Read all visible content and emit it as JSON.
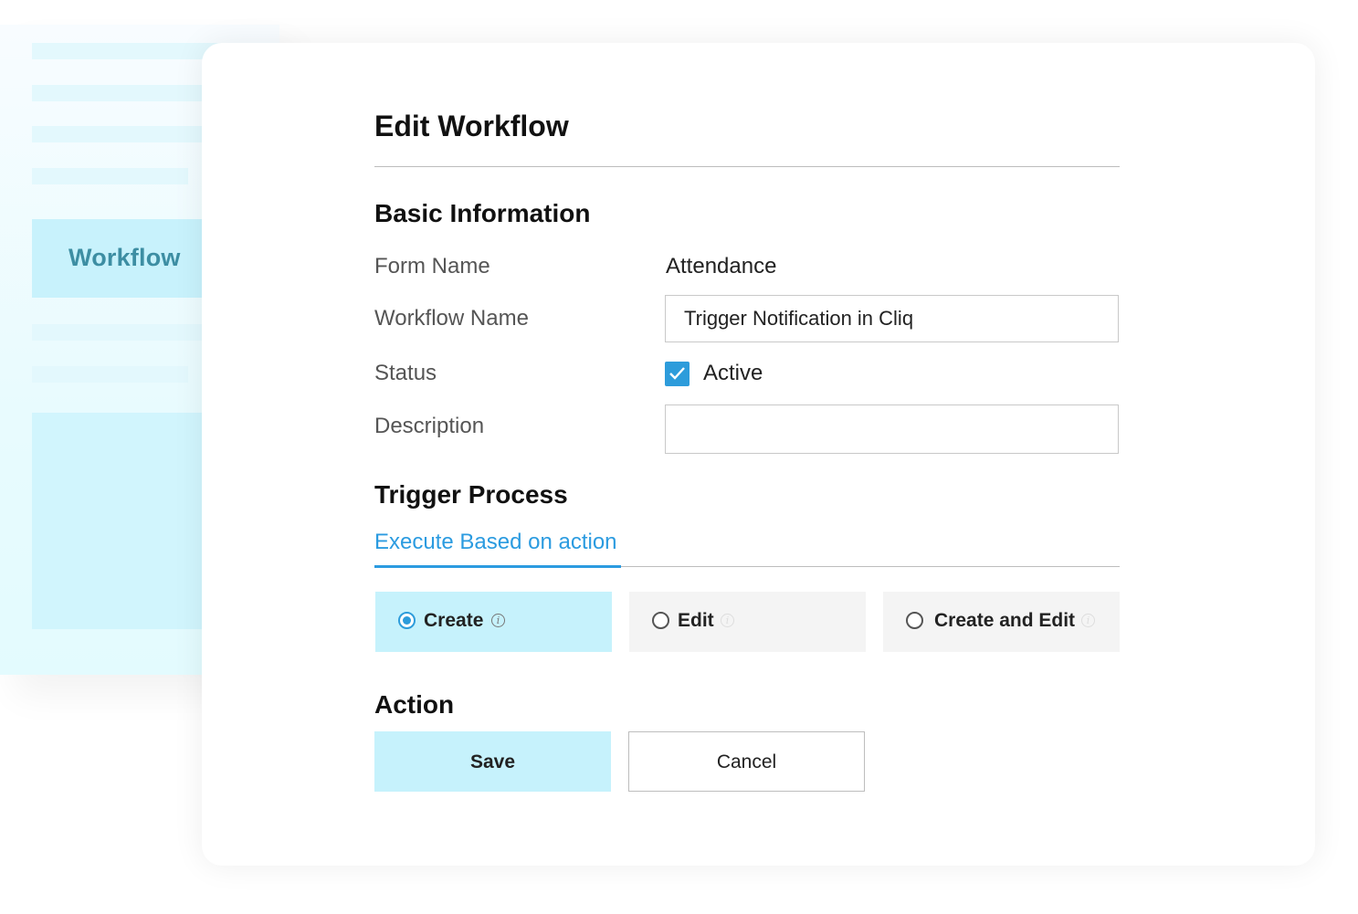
{
  "sidebar": {
    "active_item": "Workflow"
  },
  "page": {
    "title": "Edit Workflow"
  },
  "basic_info": {
    "heading": "Basic Information",
    "form_name_label": "Form Name",
    "form_name_value": "Attendance",
    "workflow_name_label": "Workflow Name",
    "workflow_name_value": "Trigger Notification in Cliq",
    "status_label": "Status",
    "status_checked": true,
    "status_value": "Active",
    "description_label": "Description",
    "description_value": ""
  },
  "trigger": {
    "heading": "Trigger Process",
    "tab_label": "Execute Based on action",
    "options": [
      {
        "label": "Create",
        "selected": true
      },
      {
        "label": "Edit",
        "selected": false
      },
      {
        "label": "Create and Edit",
        "selected": false
      }
    ],
    "info_glyph": "i"
  },
  "action": {
    "heading": "Action",
    "save_label": "Save",
    "cancel_label": "Cancel"
  },
  "colors": {
    "accent": "#2b9be0",
    "selected_bg": "#c6f2fc",
    "sidebar_active_text": "#3d8ea3"
  },
  "icons": {
    "checkbox": "check-icon",
    "info": "info-icon",
    "radio": "radio-icon"
  }
}
